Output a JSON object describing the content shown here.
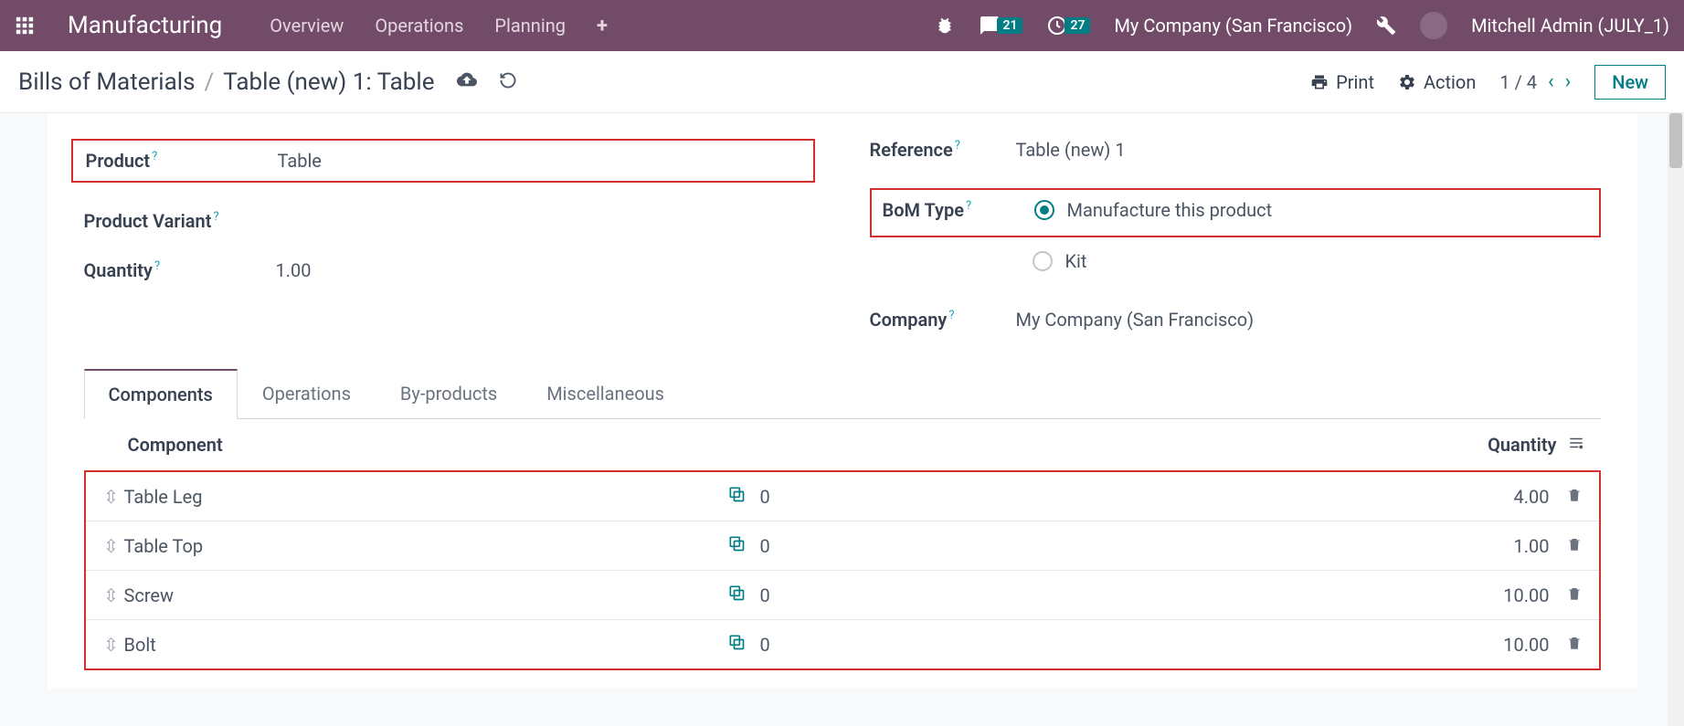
{
  "nav": {
    "brand": "Manufacturing",
    "menu": [
      "Overview",
      "Operations",
      "Planning"
    ],
    "messages_badge": "21",
    "activities_badge": "27",
    "company": "My Company (San Francisco)",
    "user": "Mitchell Admin (JULY_1)"
  },
  "toolbar": {
    "breadcrumb_root": "Bills of Materials",
    "breadcrumb_current": "Table (new) 1: Table",
    "print_label": "Print",
    "action_label": "Action",
    "pager": "1 / 4",
    "new_label": "New"
  },
  "form": {
    "product_label": "Product",
    "product_value": "Table",
    "variant_label": "Product Variant",
    "quantity_label": "Quantity",
    "quantity_value": "1.00",
    "reference_label": "Reference",
    "reference_value": "Table (new) 1",
    "bom_type_label": "BoM Type",
    "bom_type_options": {
      "manufacture": "Manufacture this product",
      "kit": "Kit"
    },
    "company_label": "Company",
    "company_value": "My Company (San Francisco)"
  },
  "tabs": [
    "Components",
    "Operations",
    "By-products",
    "Miscellaneous"
  ],
  "table": {
    "col_component": "Component",
    "col_quantity": "Quantity",
    "rows": [
      {
        "name": "Table Leg",
        "extra": "0",
        "qty": "4.00"
      },
      {
        "name": "Table Top",
        "extra": "0",
        "qty": "1.00"
      },
      {
        "name": "Screw",
        "extra": "0",
        "qty": "10.00"
      },
      {
        "name": "Bolt",
        "extra": "0",
        "qty": "10.00"
      }
    ]
  }
}
